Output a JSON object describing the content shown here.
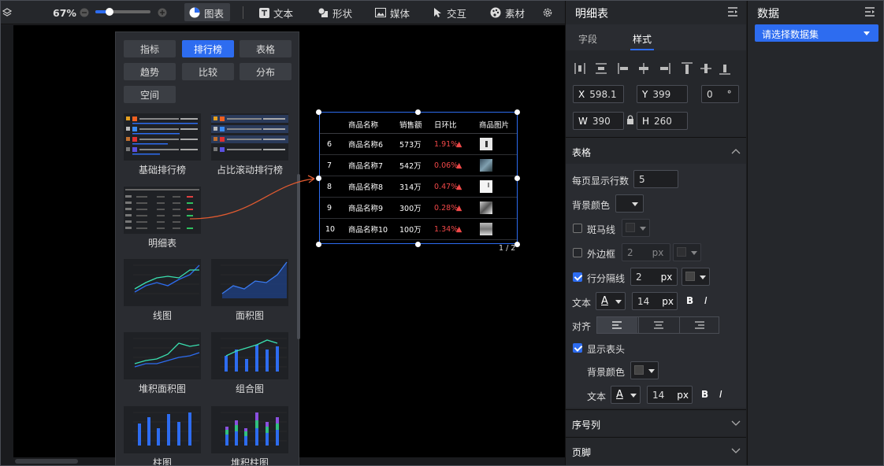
{
  "toolbar": {
    "zoom": "67%",
    "chart": "图表",
    "text": "文本",
    "shape": "形状",
    "media": "媒体",
    "interact": "交互",
    "material": "素材"
  },
  "chart_panel": {
    "categories": [
      "指标",
      "排行榜",
      "表格",
      "趋势",
      "比较",
      "分布",
      "空间"
    ],
    "charts": [
      "基础排行榜",
      "占比滚动排行榜",
      "明细表",
      "线图",
      "面积图",
      "堆积面积图",
      "组合图",
      "柱图",
      "堆积柱图"
    ]
  },
  "table": {
    "headers": [
      "商品名称",
      "销售额",
      "日环比",
      "商品图片"
    ],
    "rows": [
      {
        "n": "6",
        "name": "商品名称6",
        "sales": "573万",
        "pct": "1.91%"
      },
      {
        "n": "7",
        "name": "商品名称7",
        "sales": "542万",
        "pct": "0.06%"
      },
      {
        "n": "8",
        "name": "商品名称8",
        "sales": "314万",
        "pct": "0.47%"
      },
      {
        "n": "9",
        "name": "商品名称9",
        "sales": "300万",
        "pct": "0.28%"
      },
      {
        "n": "10",
        "name": "商品名称10",
        "sales": "100万",
        "pct": "1.34%"
      }
    ],
    "pager": "1 / 2"
  },
  "style_panel": {
    "title": "明细表",
    "tab_field": "字段",
    "tab_style": "样式",
    "x_label": "X",
    "x": "598.1",
    "y_label": "Y",
    "y": "399",
    "rot": "0",
    "deg": "°",
    "w_label": "W",
    "w": "390",
    "h_label": "H",
    "h": "260",
    "section_table": "表格",
    "rows_per_page_label": "每页显示行数",
    "rows_per_page": "5",
    "bg_color": "背景颜色",
    "zebra": "斑马线",
    "border": "外边框",
    "border_val": "2",
    "px": "px",
    "row_sep": "行分隔线",
    "row_sep_val": "2",
    "text": "文本",
    "font_size": "14",
    "bold": "B",
    "italic": "I",
    "font_a": "A",
    "align": "对齐",
    "show_header": "显示表头",
    "header_bg": "背景颜色",
    "header_text": "文本",
    "header_size": "14",
    "section_index": "序号列",
    "section_footer": "页脚"
  },
  "data_panel": {
    "title": "数据",
    "select": "请选择数据集"
  },
  "colors": {
    "accent": "#2d6cf0",
    "up": "#f04848"
  }
}
